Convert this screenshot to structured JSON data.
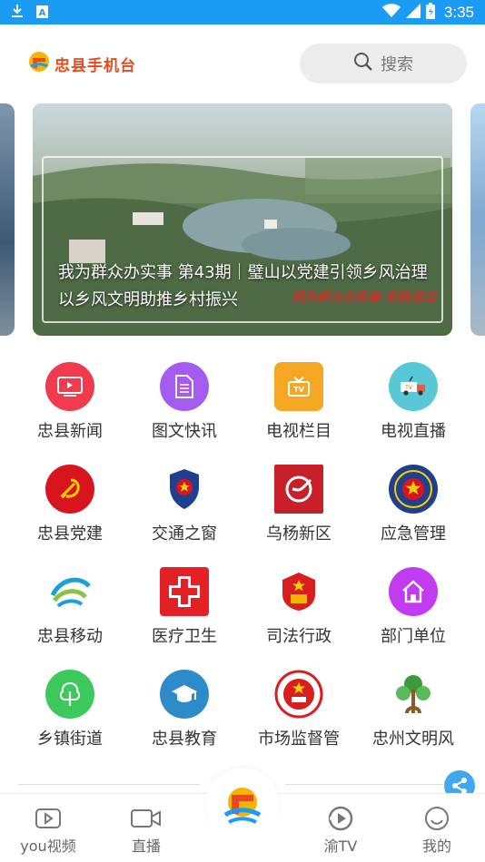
{
  "status_bar": {
    "time": "3:35",
    "icons": [
      "download-icon",
      "notification-a-icon",
      "wifi-icon",
      "signal-icon",
      "battery-icon"
    ]
  },
  "header": {
    "logo_text": "忠县手机台",
    "search_placeholder": "搜索"
  },
  "banner": {
    "title": "我为群众办实事 第43期｜璧山以党建引领乡风治理 以乡风文明助推乡村振兴",
    "stamp": "我为群众办实事 实践活动"
  },
  "grid": {
    "items": [
      {
        "label": "忠县新闻",
        "icon": "tv-news-icon",
        "color": "#f03a4e"
      },
      {
        "label": "图文快讯",
        "icon": "document-icon",
        "color": "#a45cf0"
      },
      {
        "label": "电视栏目",
        "icon": "tv-program-icon",
        "color": "#f5a623"
      },
      {
        "label": "电视直播",
        "icon": "broadcast-van-icon",
        "color": "#58c7d6"
      },
      {
        "label": "忠县党建",
        "icon": "party-emblem-icon",
        "color": "#d8141e"
      },
      {
        "label": "交通之窗",
        "icon": "police-emblem-icon",
        "color": "#1f3f8f"
      },
      {
        "label": "乌杨新区",
        "icon": "wuyang-logo-icon",
        "color": "#c8202a"
      },
      {
        "label": "应急管理",
        "icon": "emergency-emblem-icon",
        "color": "#1f3f8f"
      },
      {
        "label": "忠县移动",
        "icon": "china-mobile-icon",
        "color": "#1aa0dc"
      },
      {
        "label": "医疗卫生",
        "icon": "red-cross-icon",
        "color": "#e32026"
      },
      {
        "label": "司法行政",
        "icon": "justice-emblem-icon",
        "color": "#d81e1e"
      },
      {
        "label": "部门单位",
        "icon": "home-icon",
        "color": "#c13cf0"
      },
      {
        "label": "乡镇街道",
        "icon": "tree-icon",
        "color": "#3cc85a"
      },
      {
        "label": "忠县教育",
        "icon": "graduation-cap-icon",
        "color": "#2d8bc9"
      },
      {
        "label": "市场监督管",
        "icon": "market-supervision-icon",
        "color": "#d81e1e"
      },
      {
        "label": "忠州文明风",
        "icon": "civilization-tree-icon",
        "color": "#3a9a3c"
      }
    ]
  },
  "bottom_nav": {
    "items": [
      {
        "label": "you视频",
        "icon": "video-play-icon"
      },
      {
        "label": "直播",
        "icon": "camera-icon"
      },
      {
        "label": "渝TV",
        "icon": "tv-play-icon"
      },
      {
        "label": "我的",
        "icon": "smile-icon"
      }
    ],
    "center_icon": "app-logo-icon"
  },
  "colors": {
    "status_bar": "#1b9cf4",
    "brand": "#e84a1e",
    "share": "#3fa8f0"
  }
}
